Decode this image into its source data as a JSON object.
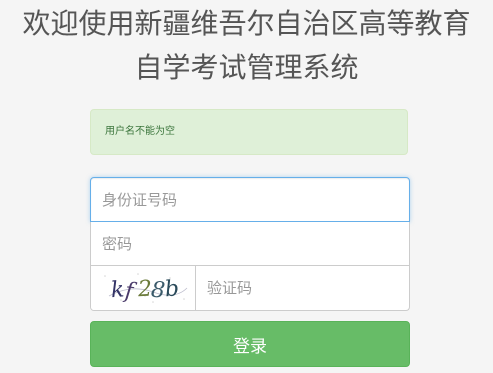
{
  "header": {
    "title_line1": "欢迎使用新疆维吾尔自治区高等教育",
    "title_line2": "自学考试管理系统"
  },
  "alert": {
    "message": "用户名不能为空"
  },
  "form": {
    "idcard_placeholder": "身份证号码",
    "password_placeholder": "密码",
    "captcha_placeholder": "验证码",
    "captcha_image_text": "kf28b",
    "login_label": "登录"
  },
  "colors": {
    "alert_bg": "#dff0d8",
    "alert_text": "#3c763d",
    "button_bg": "#5cb85c",
    "focus_border": "#66afe9"
  }
}
